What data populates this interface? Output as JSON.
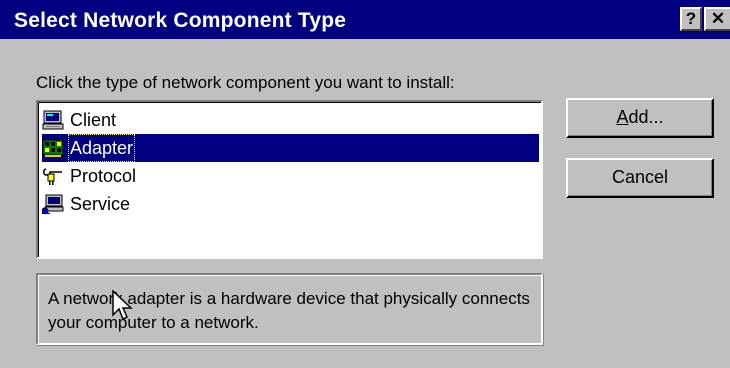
{
  "window": {
    "title": "Select Network Component Type",
    "help_label": "?",
    "close_label": "✕"
  },
  "instruction": "Click the type of network component you want to install:",
  "list": {
    "items": [
      {
        "label": "Client",
        "icon": "client-icon",
        "selected": false
      },
      {
        "label": "Adapter",
        "icon": "adapter-icon",
        "selected": true
      },
      {
        "label": "Protocol",
        "icon": "protocol-icon",
        "selected": false
      },
      {
        "label": "Service",
        "icon": "service-icon",
        "selected": false
      }
    ]
  },
  "buttons": {
    "add_accel": "A",
    "add_rest": "dd...",
    "cancel": "Cancel"
  },
  "description": "A network adapter is a hardware device that physically connects your computer to a network.",
  "colors": {
    "titlebar": "#000080",
    "face": "#c0c0c0",
    "selection": "#000080"
  }
}
